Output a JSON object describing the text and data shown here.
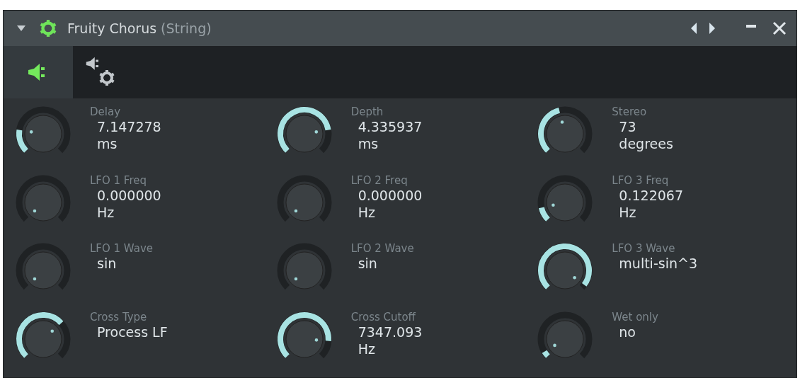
{
  "window": {
    "title": "Fruity Chorus",
    "subtitle": "(String)"
  },
  "tabs": [
    {
      "kind": "plugin",
      "selected": true
    },
    {
      "kind": "settings",
      "selected": false
    }
  ],
  "knobs": [
    {
      "name": "Delay",
      "value": "7.147278",
      "unit": "ms"
    },
    {
      "name": "Depth",
      "value": "4.335937",
      "unit": "ms"
    },
    {
      "name": "Stereo",
      "value": "73",
      "unit": "degrees"
    },
    {
      "name": "LFO 1 Freq",
      "value": "0.000000",
      "unit": "Hz"
    },
    {
      "name": "LFO 2 Freq",
      "value": "0.000000",
      "unit": "Hz"
    },
    {
      "name": "LFO 3 Freq",
      "value": "0.122067",
      "unit": "Hz"
    },
    {
      "name": "LFO 1 Wave",
      "value": "sin"
    },
    {
      "name": "LFO 2 Wave",
      "value": "sin"
    },
    {
      "name": "LFO 3 Wave",
      "value": "multi-sin^3"
    },
    {
      "name": "Cross Type",
      "value": "Process LF"
    },
    {
      "name": "Cross Cutoff",
      "value": "7347.093",
      "unit": "Hz"
    },
    {
      "name": "Wet only",
      "value": "no"
    }
  ]
}
